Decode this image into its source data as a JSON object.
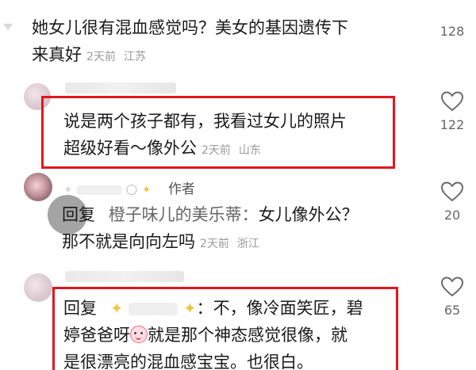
{
  "comments": [
    {
      "text_line1": "她女儿很有混血感觉吗？美女的基因遗传下",
      "text_line2": "来真好",
      "time": "2天前",
      "location": "江苏",
      "likes": "128"
    },
    {
      "text_line1": "说是两个孩子都有，我看过女儿的照片",
      "text_line2": "超级好看～像外公",
      "time": "2天前",
      "location": "山东",
      "likes": "122"
    },
    {
      "author_tag": "作者",
      "reply_prefix": "回复",
      "reply_to": "橙子味儿的美乐蒂：",
      "text_line1_rest": "女儿像外公？",
      "text_line2": "那不就是向向左吗",
      "time": "2天前",
      "location": "浙江",
      "likes": "20"
    },
    {
      "reply_prefix": "回复",
      "text_line1_rest": "：不，像冷面笑匠，碧",
      "text_line2_a": "婷爸爸呀",
      "text_line2_b": "就是那个神态感觉很像，就",
      "text_line3": "是很漂亮的混血感宝宝。也很白。",
      "likes": "65"
    }
  ],
  "icons": {
    "heart": "heart-outline-icon",
    "sparkle": "sparkle-icon",
    "emoji": "smiling-face-emoji-icon"
  },
  "colors": {
    "highlight_box": "#e0171e",
    "meta_text": "#9a9a9a",
    "like_count": "#666666"
  }
}
